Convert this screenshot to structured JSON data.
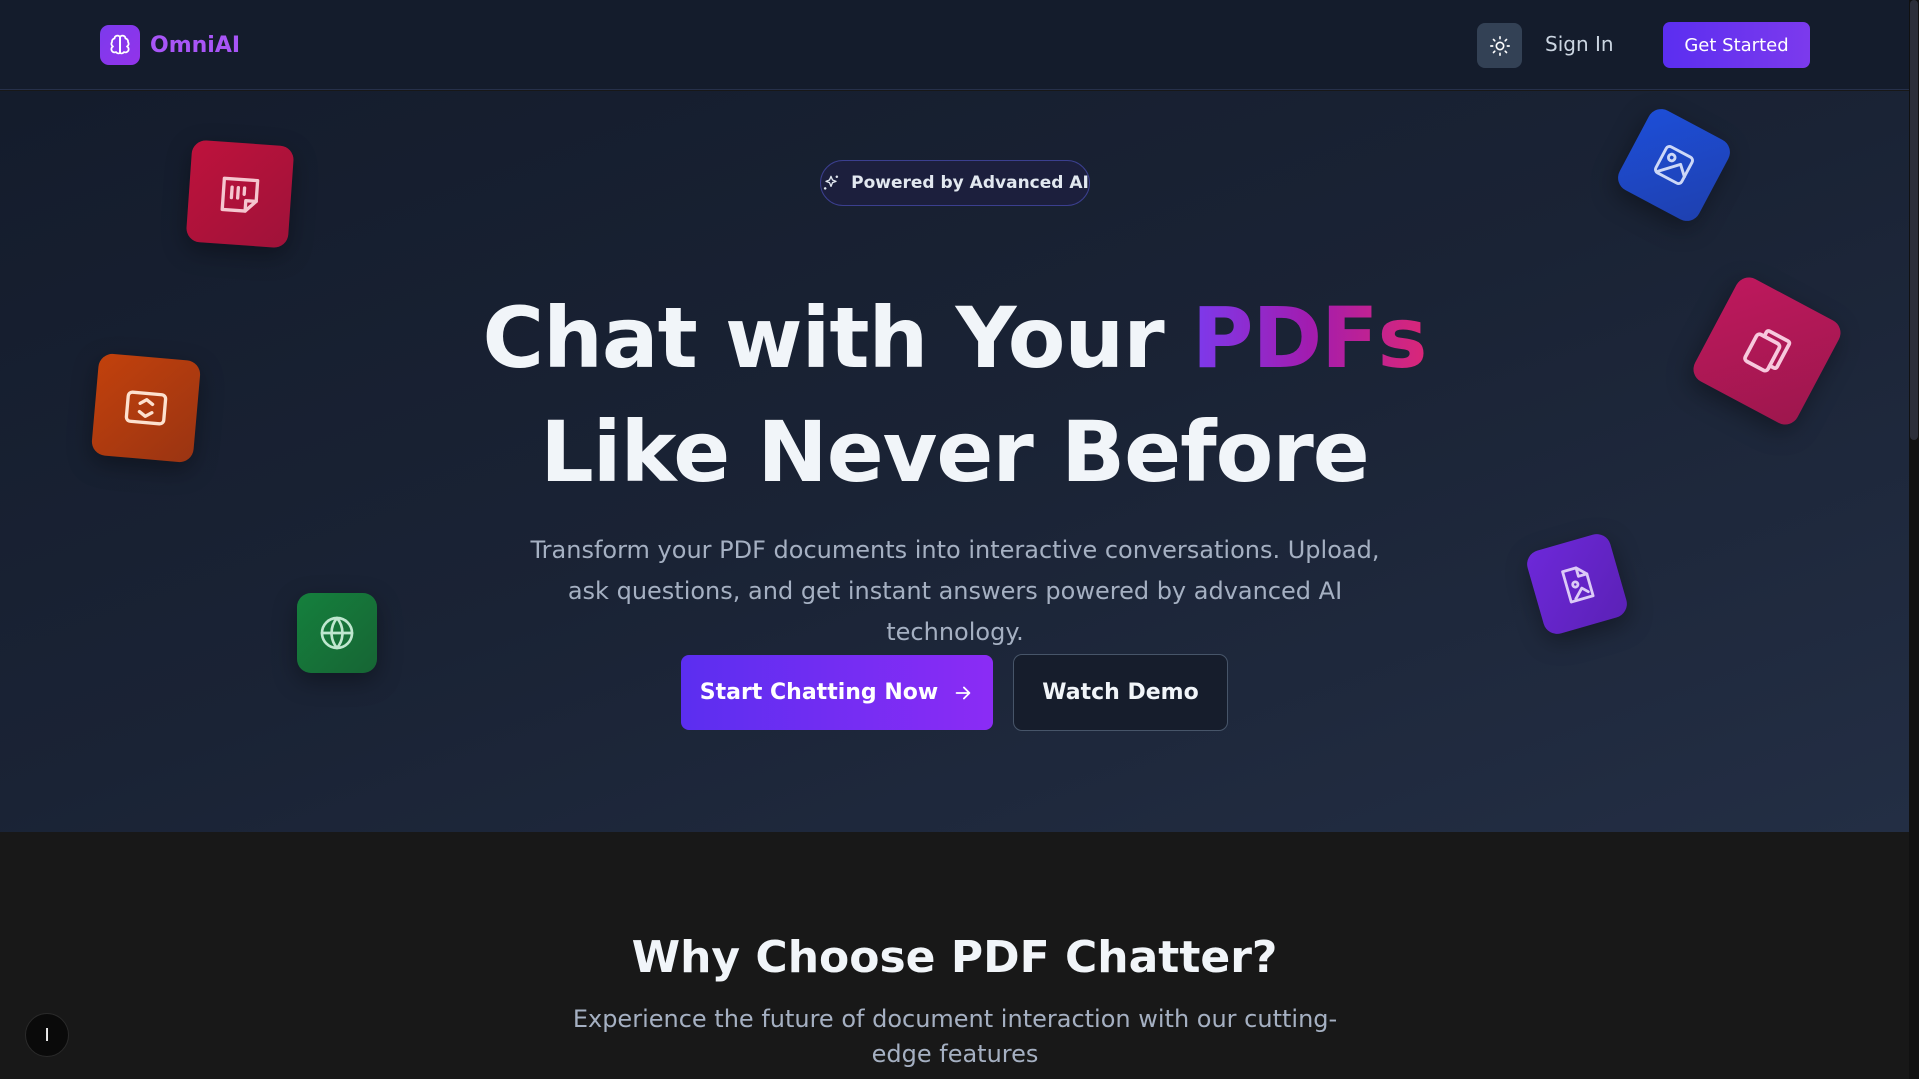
{
  "brand": {
    "name": "OmniAI",
    "icon": "brain-icon"
  },
  "nav": {
    "sign_in": "Sign In",
    "get_started": "Get Started",
    "theme_icon": "sun-icon"
  },
  "hero": {
    "badge": "Powered by Advanced AI",
    "badge_icon": "sparkles-icon",
    "headline_part1": "Chat with Your ",
    "headline_accent": "PDFs",
    "headline_line2": "Like Never Before",
    "subtitle": "Transform your PDF documents into interactive conversations. Upload, ask questions, and get instant answers powered by advanced AI technology.",
    "primary_button": "Start Chatting Now",
    "secondary_button": "Watch Demo"
  },
  "floating_icons": [
    {
      "name": "sticky-note-icon",
      "color": "#be123c"
    },
    {
      "name": "image-frame-icon",
      "color": "#c2410c"
    },
    {
      "name": "globe-icon",
      "color": "#15803d"
    },
    {
      "name": "image-icon",
      "color": "#1d4ed8"
    },
    {
      "name": "documents-icon",
      "color": "#be185d"
    },
    {
      "name": "file-image-icon",
      "color": "#6d28d9"
    }
  ],
  "features": {
    "title": "Why Choose PDF Chatter?",
    "subtitle": "Experience the future of document interaction with our cutting-edge features"
  },
  "corner_button": "I",
  "colors": {
    "accent": "#7c3aed",
    "background": "#141c2c"
  }
}
